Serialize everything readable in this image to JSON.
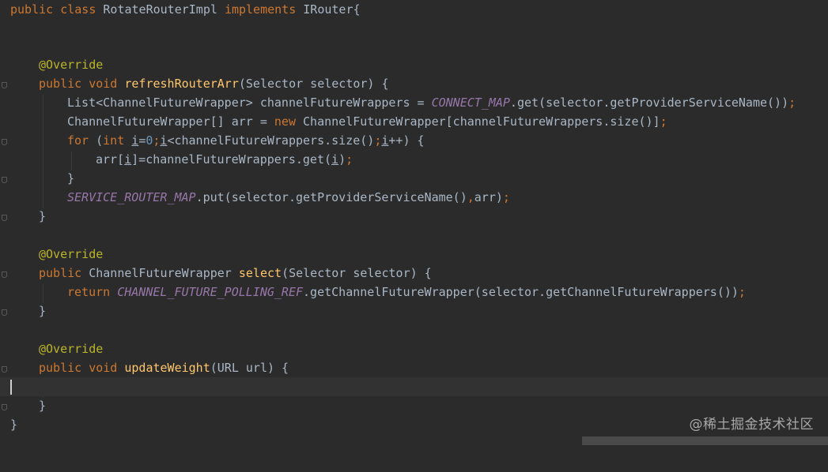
{
  "editor": {
    "lines": {
      "l1": {
        "a": "public ",
        "b": "class ",
        "c": "RotateRouterImpl ",
        "d": "implements ",
        "e": "IRouter{"
      },
      "l4": {
        "a": "@Override"
      },
      "l5": {
        "a": "public ",
        "b": "void ",
        "c": "refreshRouterArr",
        "d": "(Selector selector) {"
      },
      "l6": {
        "a": "List<ChannelFutureWrapper> channelFutureWrappers = ",
        "b": "CONNECT_MAP",
        "c": ".get(selector.getProviderServiceName())",
        "d": ";"
      },
      "l7": {
        "a": "ChannelFutureWrapper[] arr = ",
        "b": "new ",
        "c": "ChannelFutureWrapper[channelFutureWrappers.size()]",
        "d": ";"
      },
      "l8": {
        "a": "for ",
        "b": "(",
        "c": "int ",
        "d": "i",
        "e": "=",
        "f": "0",
        "g": ";",
        "h": "i",
        "i": "<channelFutureWrappers.size()",
        "j": ";",
        "k": "i",
        "m": "++) {"
      },
      "l9": {
        "a": "arr[",
        "b": "i",
        "c": "]=channelFutureWrappers.get(",
        "d": "i",
        "e": ")",
        "f": ";"
      },
      "l10": {
        "a": "}"
      },
      "l11": {
        "a": "SERVICE_ROUTER_MAP",
        "b": ".put(selector.getProviderServiceName()",
        "c": ",",
        "d": "arr)",
        "e": ";"
      },
      "l12": {
        "a": "}"
      },
      "l14": {
        "a": "@Override"
      },
      "l15": {
        "a": "public ",
        "b": "ChannelFutureWrapper ",
        "c": "select",
        "d": "(Selector selector) {"
      },
      "l16": {
        "a": "return ",
        "b": "CHANNEL_FUTURE_POLLING_REF",
        "c": ".getChannelFutureWrapper(selector.getChannelFutureWrappers())",
        "d": ";"
      },
      "l17": {
        "a": "}"
      },
      "l19": {
        "a": "@Override"
      },
      "l20": {
        "a": "public ",
        "b": "void ",
        "c": "updateWeight",
        "d": "(URL url) {"
      },
      "l22": {
        "a": "}"
      },
      "l23": {
        "a": "}"
      }
    },
    "colors": {
      "background": "#2b2b2b",
      "keyword": "#cc7832",
      "method": "#ffc66d",
      "annotation": "#bbb529",
      "static_field": "#9876aa",
      "number": "#6897bb",
      "text": "#a9b7c6"
    }
  },
  "watermark": "@稀土掘金技术社区"
}
